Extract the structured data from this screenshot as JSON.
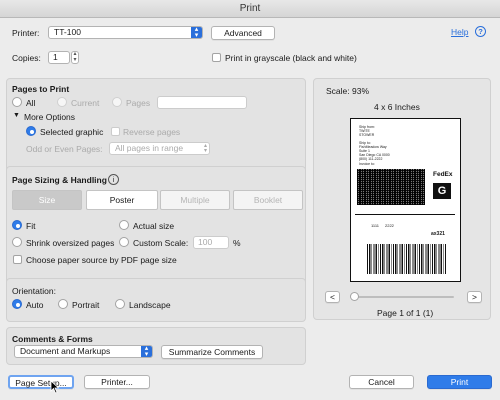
{
  "window": {
    "title": "Print"
  },
  "top": {
    "printer_label": "Printer:",
    "printer_value": "TT-100",
    "advanced_label": "Advanced",
    "help_label": "Help",
    "copies_label": "Copies:",
    "copies_value": "1",
    "grayscale_label": "Print in grayscale (black and white)"
  },
  "pages": {
    "title": "Pages to Print",
    "all_label": "All",
    "current_label": "Current",
    "pages_label": "Pages",
    "pages_value": "",
    "more_options_label": "More Options",
    "selected_graphic_label": "Selected graphic",
    "reverse_pages_label": "Reverse pages",
    "odd_even_label": "Odd or Even Pages:",
    "odd_even_value": "All pages in range"
  },
  "sizing": {
    "title": "Page Sizing & Handling",
    "tabs": [
      "Size",
      "Poster",
      "Multiple",
      "Booklet"
    ],
    "fit_label": "Fit",
    "actual_size_label": "Actual size",
    "shrink_label": "Shrink oversized pages",
    "custom_scale_label": "Custom Scale:",
    "custom_scale_value": "100",
    "percent_label": "%",
    "paper_source_label": "Choose paper source by PDF page size"
  },
  "orientation": {
    "title": "Orientation:",
    "auto_label": "Auto",
    "portrait_label": "Portrait",
    "landscape_label": "Landscape"
  },
  "comments": {
    "title": "Comments & Forms",
    "value": "Document and Markups",
    "summarize_label": "Summarize Comments"
  },
  "preview": {
    "scale_text": "Scale:  93%",
    "page_size_text": "4 x 6 Inches",
    "page_indicator": "Page 1 of 1 (1)",
    "prev_label": "<",
    "next_label": ">",
    "label_lines": [
      "Ship from:",
      "TWITE",
      "STOWER",
      "Ship to:",
      "FishMeadow Way",
      "Suite 1",
      "San Diego CA 0000",
      "(800) 111-2222",
      "Invoice to:"
    ],
    "fedex_text": "FedEx",
    "g_letter": "G",
    "bottom_numbers": [
      "1111",
      "2222",
      "ax321"
    ]
  },
  "footer": {
    "page_setup_label": "Page Setup...",
    "printer_label": "Printer...",
    "cancel_label": "Cancel",
    "print_label": "Print"
  },
  "colors": {
    "accent": "#2f7ce9",
    "link": "#2a6fdb"
  }
}
